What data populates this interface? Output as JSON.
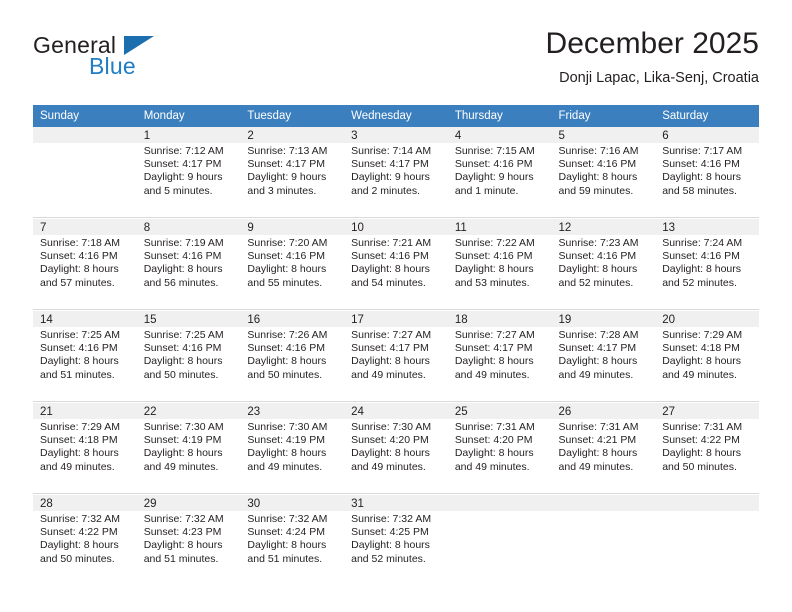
{
  "brand": {
    "name_part1": "General",
    "name_part2": "Blue",
    "triangle_icon": "triangle-icon",
    "colors": {
      "dark": "#231f20",
      "blue": "#1f7ec4",
      "triangle": "#1b6fae"
    }
  },
  "header": {
    "title": "December 2025",
    "subtitle": "Donji Lapac, Lika-Senj, Croatia"
  },
  "theme": {
    "header_row_bg": "#3c7fbf",
    "header_row_text": "#ffffff",
    "date_band_bg": "#f0f0f0",
    "grid_line": "#d9d9d9"
  },
  "weekdays": [
    "Sunday",
    "Monday",
    "Tuesday",
    "Wednesday",
    "Thursday",
    "Friday",
    "Saturday"
  ],
  "weeks": [
    [
      {
        "date": "",
        "sunrise": "",
        "sunset": "",
        "daylight1": "",
        "daylight2": ""
      },
      {
        "date": "1",
        "sunrise": "Sunrise: 7:12 AM",
        "sunset": "Sunset: 4:17 PM",
        "daylight1": "Daylight: 9 hours",
        "daylight2": "and 5 minutes."
      },
      {
        "date": "2",
        "sunrise": "Sunrise: 7:13 AM",
        "sunset": "Sunset: 4:17 PM",
        "daylight1": "Daylight: 9 hours",
        "daylight2": "and 3 minutes."
      },
      {
        "date": "3",
        "sunrise": "Sunrise: 7:14 AM",
        "sunset": "Sunset: 4:17 PM",
        "daylight1": "Daylight: 9 hours",
        "daylight2": "and 2 minutes."
      },
      {
        "date": "4",
        "sunrise": "Sunrise: 7:15 AM",
        "sunset": "Sunset: 4:16 PM",
        "daylight1": "Daylight: 9 hours",
        "daylight2": "and 1 minute."
      },
      {
        "date": "5",
        "sunrise": "Sunrise: 7:16 AM",
        "sunset": "Sunset: 4:16 PM",
        "daylight1": "Daylight: 8 hours",
        "daylight2": "and 59 minutes."
      },
      {
        "date": "6",
        "sunrise": "Sunrise: 7:17 AM",
        "sunset": "Sunset: 4:16 PM",
        "daylight1": "Daylight: 8 hours",
        "daylight2": "and 58 minutes."
      }
    ],
    [
      {
        "date": "7",
        "sunrise": "Sunrise: 7:18 AM",
        "sunset": "Sunset: 4:16 PM",
        "daylight1": "Daylight: 8 hours",
        "daylight2": "and 57 minutes."
      },
      {
        "date": "8",
        "sunrise": "Sunrise: 7:19 AM",
        "sunset": "Sunset: 4:16 PM",
        "daylight1": "Daylight: 8 hours",
        "daylight2": "and 56 minutes."
      },
      {
        "date": "9",
        "sunrise": "Sunrise: 7:20 AM",
        "sunset": "Sunset: 4:16 PM",
        "daylight1": "Daylight: 8 hours",
        "daylight2": "and 55 minutes."
      },
      {
        "date": "10",
        "sunrise": "Sunrise: 7:21 AM",
        "sunset": "Sunset: 4:16 PM",
        "daylight1": "Daylight: 8 hours",
        "daylight2": "and 54 minutes."
      },
      {
        "date": "11",
        "sunrise": "Sunrise: 7:22 AM",
        "sunset": "Sunset: 4:16 PM",
        "daylight1": "Daylight: 8 hours",
        "daylight2": "and 53 minutes."
      },
      {
        "date": "12",
        "sunrise": "Sunrise: 7:23 AM",
        "sunset": "Sunset: 4:16 PM",
        "daylight1": "Daylight: 8 hours",
        "daylight2": "and 52 minutes."
      },
      {
        "date": "13",
        "sunrise": "Sunrise: 7:24 AM",
        "sunset": "Sunset: 4:16 PM",
        "daylight1": "Daylight: 8 hours",
        "daylight2": "and 52 minutes."
      }
    ],
    [
      {
        "date": "14",
        "sunrise": "Sunrise: 7:25 AM",
        "sunset": "Sunset: 4:16 PM",
        "daylight1": "Daylight: 8 hours",
        "daylight2": "and 51 minutes."
      },
      {
        "date": "15",
        "sunrise": "Sunrise: 7:25 AM",
        "sunset": "Sunset: 4:16 PM",
        "daylight1": "Daylight: 8 hours",
        "daylight2": "and 50 minutes."
      },
      {
        "date": "16",
        "sunrise": "Sunrise: 7:26 AM",
        "sunset": "Sunset: 4:16 PM",
        "daylight1": "Daylight: 8 hours",
        "daylight2": "and 50 minutes."
      },
      {
        "date": "17",
        "sunrise": "Sunrise: 7:27 AM",
        "sunset": "Sunset: 4:17 PM",
        "daylight1": "Daylight: 8 hours",
        "daylight2": "and 49 minutes."
      },
      {
        "date": "18",
        "sunrise": "Sunrise: 7:27 AM",
        "sunset": "Sunset: 4:17 PM",
        "daylight1": "Daylight: 8 hours",
        "daylight2": "and 49 minutes."
      },
      {
        "date": "19",
        "sunrise": "Sunrise: 7:28 AM",
        "sunset": "Sunset: 4:17 PM",
        "daylight1": "Daylight: 8 hours",
        "daylight2": "and 49 minutes."
      },
      {
        "date": "20",
        "sunrise": "Sunrise: 7:29 AM",
        "sunset": "Sunset: 4:18 PM",
        "daylight1": "Daylight: 8 hours",
        "daylight2": "and 49 minutes."
      }
    ],
    [
      {
        "date": "21",
        "sunrise": "Sunrise: 7:29 AM",
        "sunset": "Sunset: 4:18 PM",
        "daylight1": "Daylight: 8 hours",
        "daylight2": "and 49 minutes."
      },
      {
        "date": "22",
        "sunrise": "Sunrise: 7:30 AM",
        "sunset": "Sunset: 4:19 PM",
        "daylight1": "Daylight: 8 hours",
        "daylight2": "and 49 minutes."
      },
      {
        "date": "23",
        "sunrise": "Sunrise: 7:30 AM",
        "sunset": "Sunset: 4:19 PM",
        "daylight1": "Daylight: 8 hours",
        "daylight2": "and 49 minutes."
      },
      {
        "date": "24",
        "sunrise": "Sunrise: 7:30 AM",
        "sunset": "Sunset: 4:20 PM",
        "daylight1": "Daylight: 8 hours",
        "daylight2": "and 49 minutes."
      },
      {
        "date": "25",
        "sunrise": "Sunrise: 7:31 AM",
        "sunset": "Sunset: 4:20 PM",
        "daylight1": "Daylight: 8 hours",
        "daylight2": "and 49 minutes."
      },
      {
        "date": "26",
        "sunrise": "Sunrise: 7:31 AM",
        "sunset": "Sunset: 4:21 PM",
        "daylight1": "Daylight: 8 hours",
        "daylight2": "and 49 minutes."
      },
      {
        "date": "27",
        "sunrise": "Sunrise: 7:31 AM",
        "sunset": "Sunset: 4:22 PM",
        "daylight1": "Daylight: 8 hours",
        "daylight2": "and 50 minutes."
      }
    ],
    [
      {
        "date": "28",
        "sunrise": "Sunrise: 7:32 AM",
        "sunset": "Sunset: 4:22 PM",
        "daylight1": "Daylight: 8 hours",
        "daylight2": "and 50 minutes."
      },
      {
        "date": "29",
        "sunrise": "Sunrise: 7:32 AM",
        "sunset": "Sunset: 4:23 PM",
        "daylight1": "Daylight: 8 hours",
        "daylight2": "and 51 minutes."
      },
      {
        "date": "30",
        "sunrise": "Sunrise: 7:32 AM",
        "sunset": "Sunset: 4:24 PM",
        "daylight1": "Daylight: 8 hours",
        "daylight2": "and 51 minutes."
      },
      {
        "date": "31",
        "sunrise": "Sunrise: 7:32 AM",
        "sunset": "Sunset: 4:25 PM",
        "daylight1": "Daylight: 8 hours",
        "daylight2": "and 52 minutes."
      },
      {
        "date": "",
        "sunrise": "",
        "sunset": "",
        "daylight1": "",
        "daylight2": ""
      },
      {
        "date": "",
        "sunrise": "",
        "sunset": "",
        "daylight1": "",
        "daylight2": ""
      },
      {
        "date": "",
        "sunrise": "",
        "sunset": "",
        "daylight1": "",
        "daylight2": ""
      }
    ]
  ]
}
